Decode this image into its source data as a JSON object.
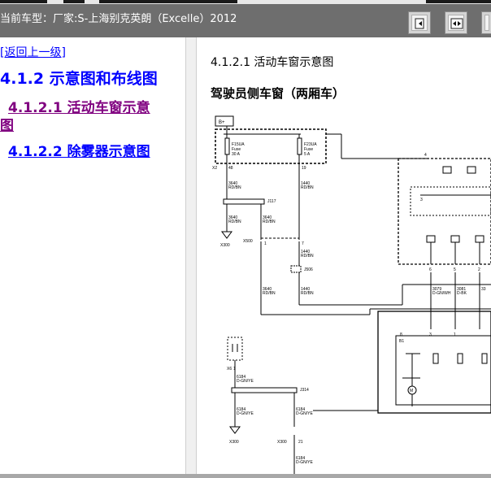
{
  "header": {
    "title": "当前车型：厂家:S-上海别克英朗（Excelle）2012"
  },
  "toolbar": {
    "buttons": [
      {
        "name": "page-left-icon"
      },
      {
        "name": "page-fit-icon"
      },
      {
        "name": "page-right-icon"
      }
    ]
  },
  "nav": {
    "back_label": "[返回上一级]",
    "section_heading": "4.1.2 示意图和布线图",
    "items": [
      {
        "label_line1": "4.1.2.1 活动车窗示意",
        "label_line2": "图"
      },
      {
        "label": "4.1.2.2 除雾器示意图"
      }
    ]
  },
  "content": {
    "heading": "4.1.2.1 活动车窗示意图",
    "subheading": "驾驶员侧车窗（两厢车）"
  },
  "diagram": {
    "labels": {
      "bplus": "B+",
      "fuse1_name": "F15UA",
      "fuse1_label": "Fuse",
      "fuse1_amp": "30 A",
      "fuse2_name": "F23UA",
      "fuse2_label": "Fuse",
      "fuse2_amp": "5 A",
      "x2": "X2",
      "pin48": "48",
      "pin_c": "19",
      "w3640_a": "3640",
      "w_rdbn_a": "RD/BN",
      "w1440_a": "1440",
      "w_rdbn_b": "RD/BN",
      "j117": "J117",
      "w3640_b": "3640",
      "w_rdbn_c": "RD/BN",
      "w3640_c": "3640",
      "w_rdbn_d": "RD/BN",
      "x300_a": "X300",
      "x500": "X500",
      "pin1": "1",
      "pin7": "7",
      "w1440_b": "1440",
      "w_rdbn_e": "RD/BN",
      "j506": "J506",
      "w3640_d": "3640",
      "w_rdbn_f": "RD/BN",
      "w1440_c": "1440",
      "w_rdbn_g": "RD/BN",
      "x6": "X6",
      "w6184_a": "6184",
      "w_dgnye_a": "D-GN/YE",
      "j314": "J314",
      "w6184_b": "6184",
      "w_dgnye_b": "D-GN/YE",
      "w6184_c": "6184",
      "w_dgnye_c": "D-GN/YE",
      "x300_b": "X300",
      "x300_c": "X300",
      "pin21": "21",
      "w6184_d": "6184",
      "w_dgnye_d": "D-GN/YE",
      "pin4": "4",
      "pin3_a": "3",
      "pin6": "6",
      "pin5": "5",
      "pin2": "2",
      "w3079": "3079",
      "w_dgnwh": "D-GN/WH",
      "w3081": "3081",
      "w_dbk": "D-BK",
      "w33": "33",
      "b1": "B1",
      "m1": "M",
      "pin8": "8",
      "pin3_b": "3",
      "pin1_b": "1",
      "x6_pin": "1"
    }
  }
}
